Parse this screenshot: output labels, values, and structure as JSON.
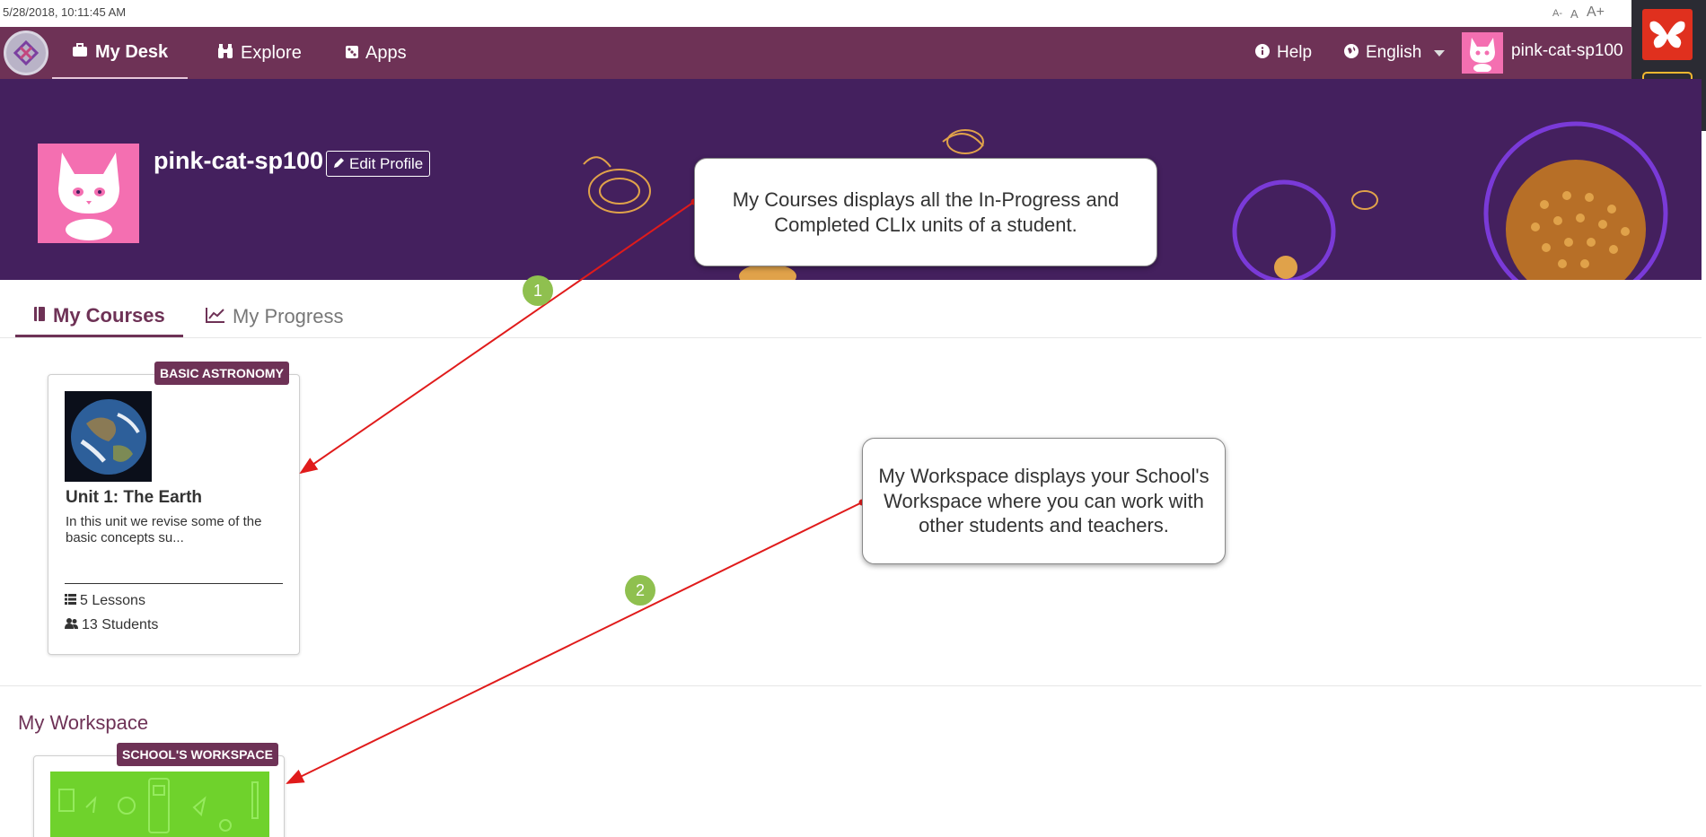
{
  "top_bar": {
    "timestamp": "5/28/2018, 10:11:45 AM",
    "font_small": "A-",
    "font_normal": "A",
    "font_large": "A+"
  },
  "nav": {
    "items": [
      {
        "label": "My Desk",
        "icon": "briefcase-icon"
      },
      {
        "label": "Explore",
        "icon": "binoculars-icon"
      },
      {
        "label": "Apps",
        "icon": "dice-icon"
      }
    ],
    "help": "Help",
    "language": "English",
    "username": "pink-cat-sp100"
  },
  "profile": {
    "name": "pink-cat-sp100",
    "edit_label": "Edit Profile"
  },
  "callouts": {
    "courses_text": "My Courses displays all the In-Progress and Completed CLIx units of a student.",
    "workspace_text": "My Workspace displays your School's Workspace where you can work with other students and teachers.",
    "step1": "1",
    "step2": "2"
  },
  "tabs": [
    {
      "label": "My Courses",
      "icon": "book-icon",
      "active": true
    },
    {
      "label": "My Progress",
      "icon": "line-chart-icon",
      "active": false
    }
  ],
  "course": {
    "badge": "BASIC ASTRONOMY",
    "title": "Unit 1: The Earth",
    "description": "In this unit we revise some of the basic concepts su...",
    "lessons": "5 Lessons",
    "students": "13 Students"
  },
  "workspace": {
    "title": "My Workspace",
    "badge": "SCHOOL'S WORKSPACE"
  },
  "colors": {
    "navbar": "#6e3256",
    "banner": "#44205e",
    "accent": "#6e3256",
    "step": "#8fc04f",
    "arrow": "#e01b1b"
  }
}
